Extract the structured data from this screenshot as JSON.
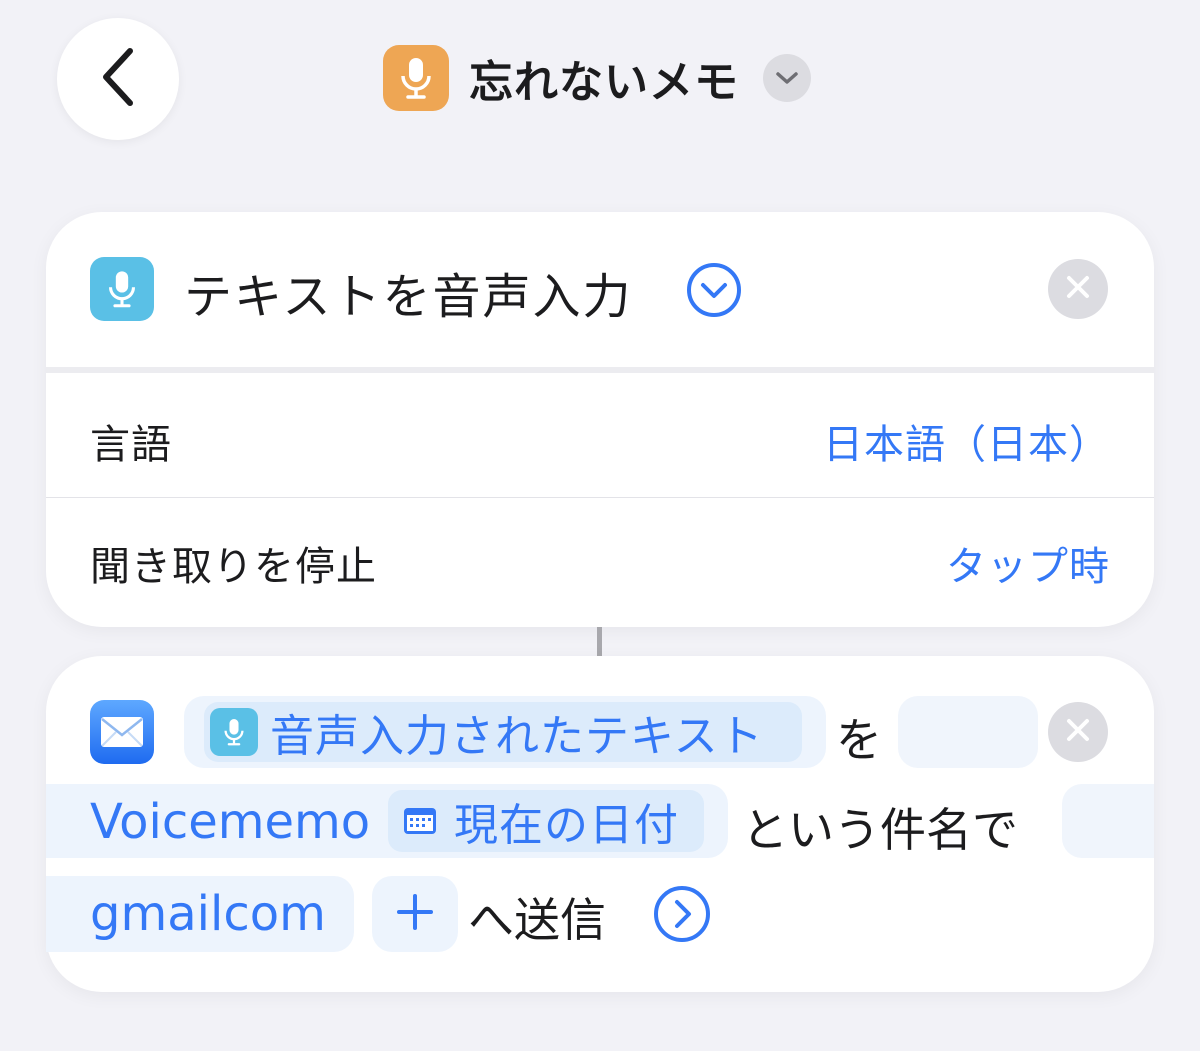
{
  "header": {
    "back_icon": "chevron-left-icon",
    "shortcut_name": "忘れないメモ",
    "shortcut_icon": "microphone-icon",
    "shortcut_icon_color": "#eea654",
    "menu_icon": "chevron-down-icon"
  },
  "dictate_action": {
    "title": "テキストを音声入力",
    "icon": "microphone-icon",
    "icon_color": "#5ac0e6",
    "expand_icon": "chevron-down-circle-icon",
    "remove_icon": "close-icon",
    "rows": [
      {
        "label": "言語",
        "value": "日本語（日本）"
      },
      {
        "label": "聞き取りを停止",
        "value": "タップ時"
      }
    ]
  },
  "mail_action": {
    "icon": "mail-icon",
    "remove_icon": "close-icon",
    "variable_label": "音声入力されたテキスト",
    "variable_icon": "microphone-icon",
    "connector_wo": "を",
    "subject_prefix": "Voicememo",
    "date_variable_label": "現在の日付",
    "date_icon": "calendar-icon",
    "subject_suffix": "という件名で",
    "recipient": "gmailcom",
    "add_icon": "plus-icon",
    "send_label": "へ送信",
    "more_icon": "chevron-right-circle-icon"
  },
  "colors": {
    "accent": "#3478f6",
    "background": "#f2f2f7"
  }
}
